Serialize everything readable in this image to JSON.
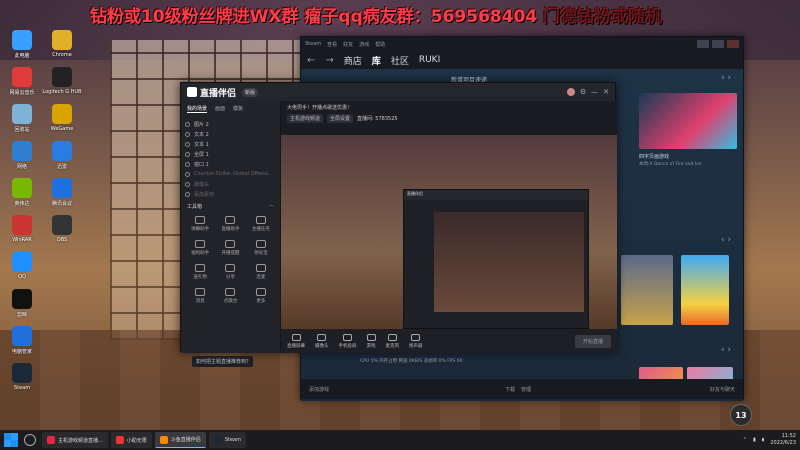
{
  "overlay": {
    "banner_text": "钻粉或10级粉丝牌进WX群  瘤子qq病友群：569568404",
    "banner_faded": "门德钻粉或随机"
  },
  "desktop": {
    "icons": [
      {
        "label": "此电脑",
        "color": "#3aa0ff"
      },
      {
        "label": "网易云音乐",
        "color": "#e03a3a"
      },
      {
        "label": "回收站",
        "color": "#7fb2d9"
      },
      {
        "label": "网络",
        "color": "#2f7fd0"
      },
      {
        "label": "英伟达",
        "color": "#76b900"
      },
      {
        "label": "WinRAR",
        "color": "#c33"
      },
      {
        "label": "QQ",
        "color": "#1e90ff"
      },
      {
        "label": "剪映",
        "color": "#111"
      },
      {
        "label": "电脑管家",
        "color": "#2070e0"
      },
      {
        "label": "Steam",
        "color": "#1b2838"
      },
      {
        "label": "Chrome",
        "color": "#e0b02a"
      },
      {
        "label": "Logitech G HUB",
        "color": "#222"
      },
      {
        "label": "WeGame",
        "color": "#d9a300"
      },
      {
        "label": "迅雷",
        "color": "#2a7de0"
      },
      {
        "label": "腾讯会议",
        "color": "#1e6fe0"
      },
      {
        "label": "OBS",
        "color": "#333"
      }
    ]
  },
  "steam": {
    "menu": [
      "Steam",
      "查看",
      "好友",
      "游戏",
      "帮助"
    ],
    "nav": {
      "store": "商店",
      "library": "库",
      "community": "社区",
      "user": "RUKI"
    },
    "section_new": "新增项目速递",
    "featured_caption": "四字贝画游戏",
    "featured_sub": "本周·A Dance of Fire and Ice",
    "footer_add": "添加游戏",
    "footer_downloads": "下载",
    "footer_manage": "管理",
    "footer_friends": "好友与聊天"
  },
  "companion": {
    "app_name": "直播伴侣",
    "version": "新版",
    "left_tabs": [
      "我的场景",
      "画面",
      "模板"
    ],
    "scenes": [
      {
        "label": "图片 2",
        "dim": false
      },
      {
        "label": "文本 2",
        "dim": false
      },
      {
        "label": "文本 1",
        "dim": false
      },
      {
        "label": "全屏 1",
        "dim": false
      },
      {
        "label": "窗口 1",
        "dim": false
      },
      {
        "label": "Counter-Strike: Global Offensive - Direct3D 9",
        "dim": true
      },
      {
        "label": "摄像头",
        "dim": true
      },
      {
        "label": "添加素材",
        "dim": true
      }
    ],
    "tools_title": "工具箱",
    "tools": [
      "弹幕助手",
      "直播助手",
      "主播任务",
      "福利助手",
      "开播提醒",
      "领号宝",
      "送礼物",
      "分享",
      "连麦",
      "消息",
      "点歌台",
      "更多"
    ],
    "stream_title": "大佬周手！开播点歌送优惠！",
    "tag1": "主机游戏频道",
    "tag2": "全局设置",
    "live_stats": "直播间: 5783525",
    "bottom_tip": "如何把主题直播推荐到?",
    "controls": [
      "直播屏幕",
      "摄像头",
      "手机投屏",
      "游戏",
      "麦克风",
      "扬声器"
    ],
    "start_button": "开始直播",
    "nested_title": "直播伴侣",
    "stats_line": "CPU 5% 内存占用 网速 0KB/S  丢帧率 0%  FPS 60"
  },
  "taskbar": {
    "items": [
      {
        "label": "主机游戏频道直播...",
        "color": "#e24"
      },
      {
        "label": "小助无限",
        "color": "#e33"
      },
      {
        "label": "斗鱼直播伴侣",
        "color": "#f80"
      },
      {
        "label": "Steam",
        "color": "#1b2838"
      }
    ],
    "time": "11:52",
    "date": "2022/6/23",
    "notif": "13"
  }
}
